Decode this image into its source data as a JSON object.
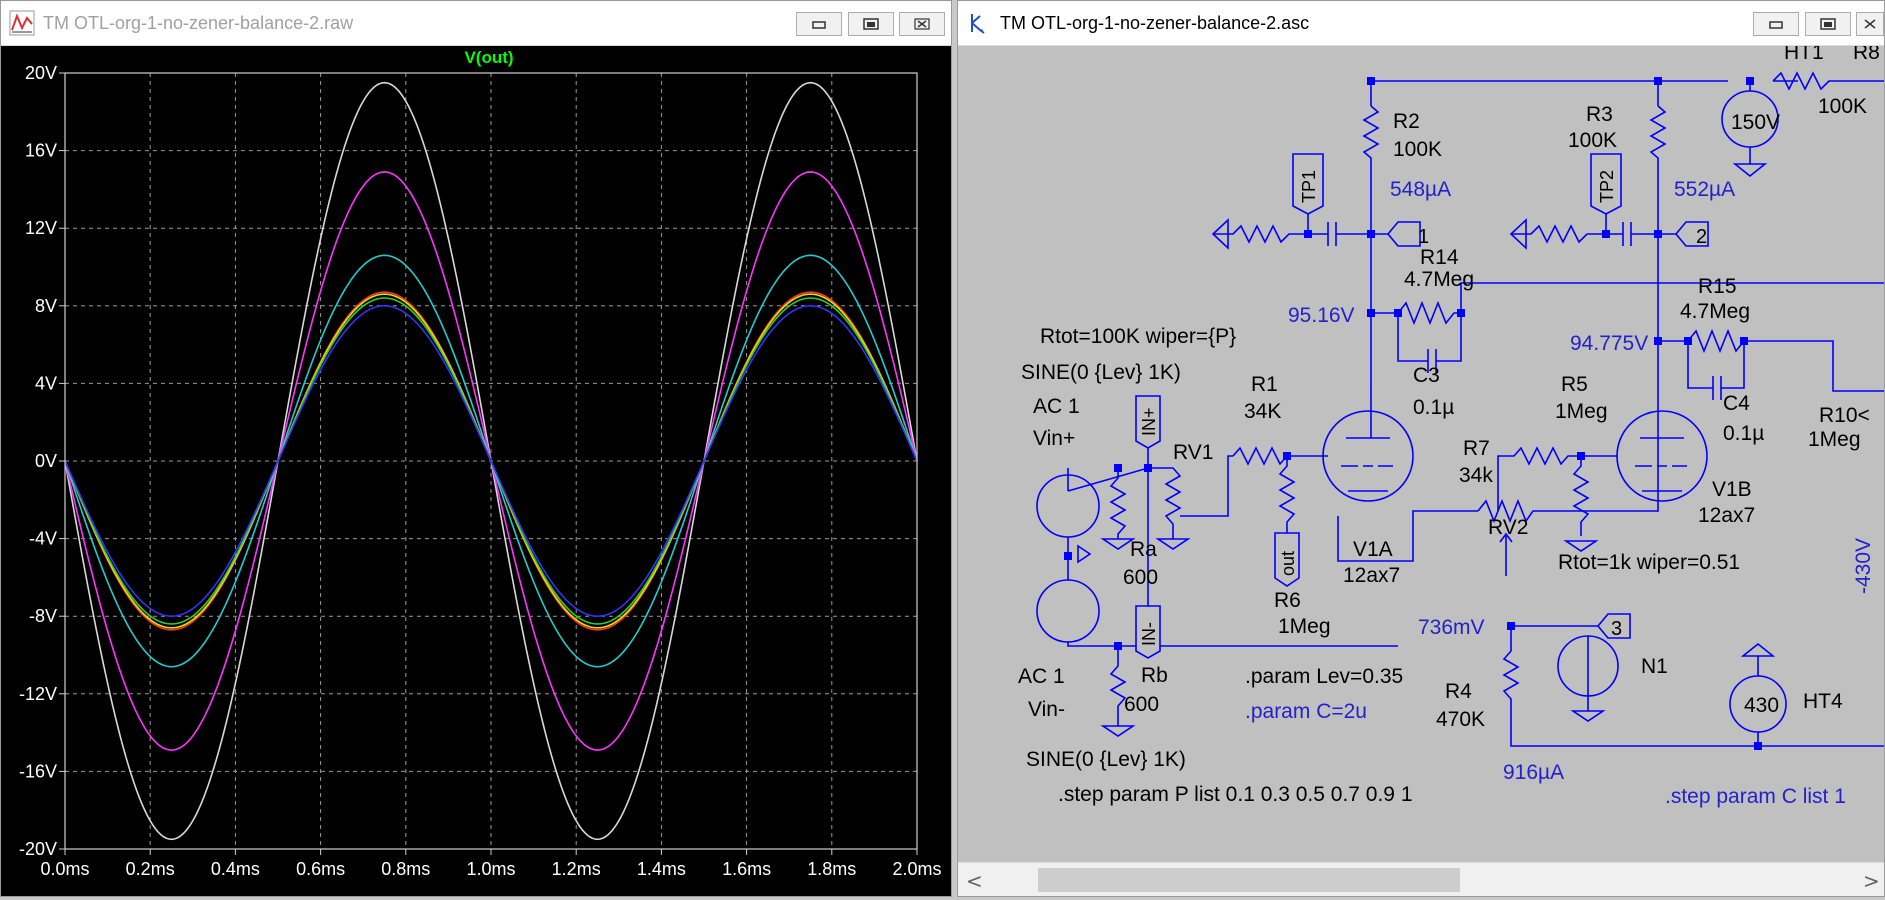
{
  "waveform_window": {
    "title": "TM OTL-org-1-no-zener-balance-2.raw",
    "icon": "waveform-app-icon",
    "buttons": [
      "minimize-icon",
      "maximize-icon",
      "close-icon"
    ]
  },
  "schematic_window": {
    "title": "TM OTL-org-1-no-zener-balance-2.asc",
    "icon": "schematic-app-icon",
    "buttons": [
      "minimize-icon",
      "maximize-icon",
      "close-icon"
    ]
  },
  "chart_data": {
    "type": "line",
    "trace_label": "V(out)",
    "y_ticks": [
      "20V",
      "16V",
      "12V",
      "8V",
      "4V",
      "0V",
      "-4V",
      "-8V",
      "-12V",
      "-16V",
      "-20V"
    ],
    "x_ticks": [
      "0.0ms",
      "0.2ms",
      "0.4ms",
      "0.6ms",
      "0.8ms",
      "1.0ms",
      "1.2ms",
      "1.4ms",
      "1.6ms",
      "1.8ms",
      "2.0ms"
    ],
    "xlim": [
      0,
      2.0
    ],
    "ylim": [
      -20,
      20
    ],
    "grid": true,
    "series": [
      {
        "color": "#d8d8d8",
        "values": [
          -19.5,
          19.5,
          -19.5,
          19.5
        ]
      },
      {
        "color": "#ff33ff",
        "values": [
          -14.9,
          14.9,
          -14.9,
          14.9
        ]
      },
      {
        "color": "#22cccc",
        "values": [
          -10.6,
          10.6,
          -10.6,
          10.6
        ]
      },
      {
        "color": "#ff3333",
        "values": [
          -8.7,
          8.7,
          -8.7,
          8.7
        ]
      },
      {
        "color": "#e0e000",
        "values": [
          -8.6,
          8.6,
          -8.6,
          8.6
        ]
      },
      {
        "color": "#33cc33",
        "values": [
          -8.4,
          8.4,
          -8.4,
          8.4
        ]
      },
      {
        "color": "#3333ff",
        "values": [
          -8.0,
          8.0,
          -8.0,
          8.0
        ]
      }
    ],
    "peak_x_ms": [
      0.25,
      0.75,
      1.25,
      1.75
    ]
  },
  "schematic": {
    "labels": {
      "ht1": "HT1",
      "r8": "R8",
      "r8_val": "100K",
      "ht1_val": "150V",
      "r2": "R2",
      "r2_val": "100K",
      "r2_cur": "548µA",
      "r3": "R3",
      "r3_val": "100K",
      "r3_cur": "552µA",
      "tp1": "TP1",
      "tp2": "TP2",
      "port1": "1",
      "port2": "2",
      "port3": "3",
      "r14": "R14",
      "r14_val": "4.7Meg",
      "r15": "R15",
      "r15_val": "4.7Meg",
      "v_node1": "95.16V",
      "v_node2": "94.775V",
      "c3": "C3",
      "c3_val": "0.1µ",
      "c4": "C4",
      "c4_val": "0.1µ",
      "rtot1": "Rtot=100K wiper={P}",
      "sine1": "SINE(0 {Lev} 1K)",
      "ac1": "AC 1",
      "vinp": "Vin+",
      "inp": "IN+",
      "inm": "IN-",
      "r1": "R1",
      "r1_val": "34K",
      "rv1": "RV1",
      "r5": "R5",
      "r5_val": "1Meg",
      "r7": "R7",
      "r7_val": "34k",
      "r10": "R10<",
      "r10_val": "1Meg",
      "v1b": "V1B",
      "v1b_type": "12ax7",
      "v1a": "V1A",
      "v1a_type": "12ax7",
      "rv2": "RV2",
      "rtot2": "Rtot=1k wiper=0.51",
      "neg430": "-430V",
      "ra": "Ra",
      "ra_val": "600",
      "rb": "Rb",
      "rb_val": "600",
      "out": "out",
      "r6": "R6",
      "r6_val": "1Meg",
      "v736": "736mV",
      "n1": "N1",
      "ac2": "AC 1",
      "vinm": "Vin-",
      "sine2": "SINE(0 {Lev} 1K)",
      "param_lev": ".param Lev=0.35",
      "param_c": ".param C=2u",
      "r4": "R4",
      "r4_val": "470K",
      "ht4": "HT4",
      "ht4_val": "430",
      "r4_cur": "916µA",
      "step_p": ".step param P list 0.1 0.3 0.5 0.7 0.9 1",
      "step_c": ".step param C list 1"
    }
  },
  "scrollbar": {
    "left_arrow": "<",
    "right_arrow": ">"
  }
}
